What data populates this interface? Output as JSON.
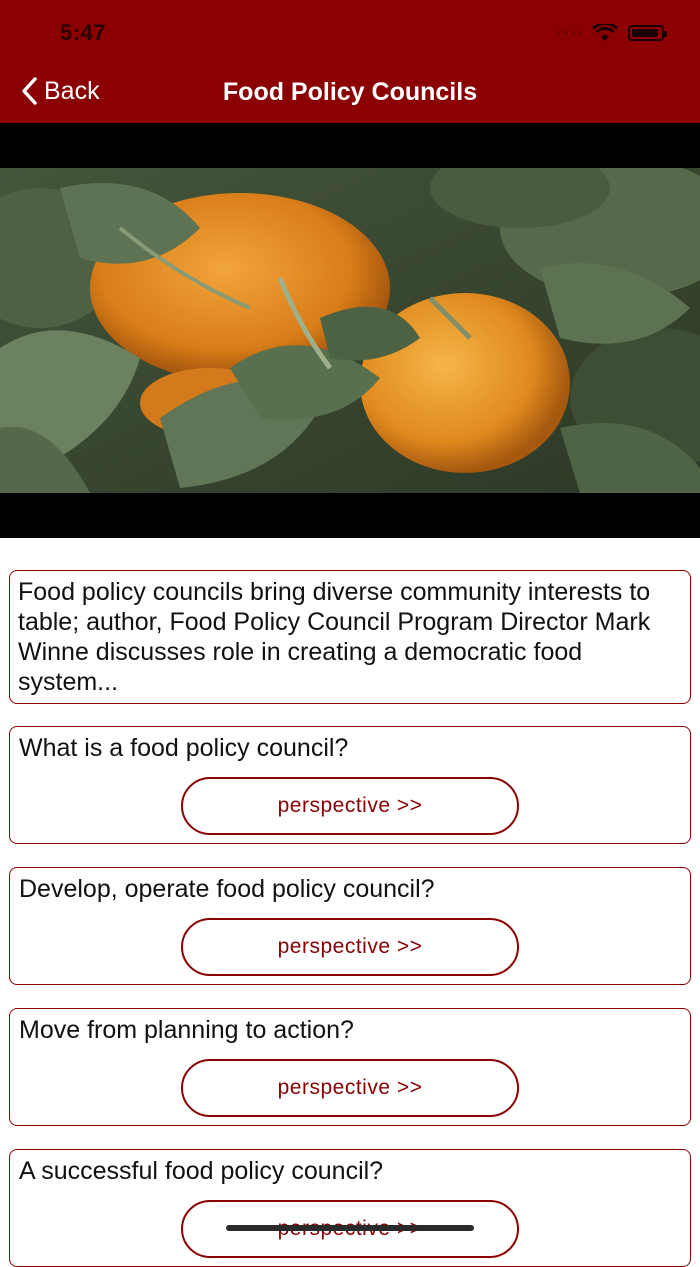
{
  "status_bar": {
    "time": "5:47"
  },
  "nav": {
    "back_label": "Back",
    "title": "Food Policy Councils"
  },
  "video": {
    "description_icon": "video-thumbnail"
  },
  "intro": {
    "text": "Food policy councils bring diverse community interests to table; author, Food Policy Council Program Director Mark Winne discusses role in creating a democratic food system..."
  },
  "questions": [
    {
      "question": "What is a food policy council?",
      "button_label": "perspective >>"
    },
    {
      "question": "Develop, operate food policy council?",
      "button_label": "perspective >>"
    },
    {
      "question": "Move from planning to action?",
      "button_label": "perspective >>"
    },
    {
      "question": "A successful food policy council?",
      "button_label": "perspective >>"
    }
  ],
  "colors": {
    "brand": "#8b0000",
    "background": "#ffffff",
    "text": "#111111"
  }
}
